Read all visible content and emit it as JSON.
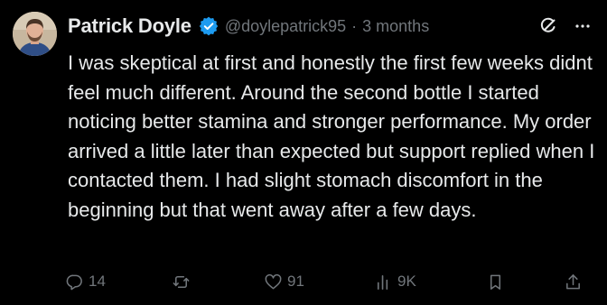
{
  "tweet": {
    "display_name": "Patrick Doyle",
    "handle": "@doylepatrick95",
    "separator": "·",
    "timestamp": "3 months",
    "text": "I was skeptical at first and honestly the first few weeks didnt feel much different. Around the second bottle I started noticing better stamina and stronger performance. My order arrived a little later than expected but support replied when I contacted them. I had slight stomach discomfort in the beginning but that went away after a few days.",
    "verified": true
  },
  "actions": {
    "replies": "14",
    "reposts": "",
    "likes": "91",
    "views": "9K"
  },
  "colors": {
    "background": "#000000",
    "text": "#e7e9ea",
    "muted": "#71767b",
    "verified_badge": "#1d9bf0"
  },
  "icons": {
    "top_right": [
      "grok-icon",
      "more-icon"
    ],
    "action_bar": [
      "reply-icon",
      "repost-icon",
      "like-icon",
      "views-icon",
      "bookmark-icon",
      "share-icon"
    ]
  }
}
